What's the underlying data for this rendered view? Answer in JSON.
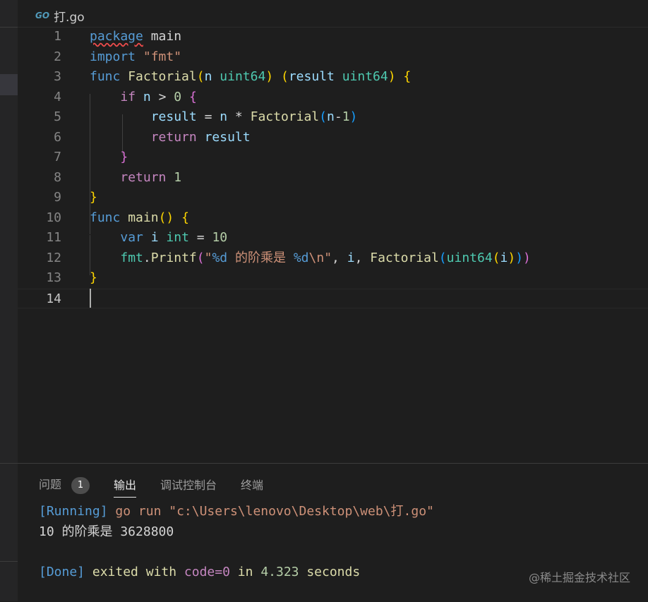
{
  "tab": {
    "icon": "go-file-icon",
    "icon_text": "GO",
    "filename": "打.go"
  },
  "editor": {
    "current_line": "14",
    "lines": [
      {
        "n": "1",
        "segs": [
          {
            "t": "package",
            "c": "kw squiggle"
          },
          {
            "t": " main",
            "c": ""
          }
        ]
      },
      {
        "n": "2",
        "segs": [
          {
            "t": "import",
            "c": "kw"
          },
          {
            "t": " ",
            "c": ""
          },
          {
            "t": "\"fmt\"",
            "c": "str"
          }
        ]
      },
      {
        "n": "3",
        "segs": [
          {
            "t": "func",
            "c": "kw"
          },
          {
            "t": " ",
            "c": ""
          },
          {
            "t": "Factorial",
            "c": "fn"
          },
          {
            "t": "(",
            "c": "b1"
          },
          {
            "t": "n ",
            "c": "vr"
          },
          {
            "t": "uint64",
            "c": "ty"
          },
          {
            "t": ")",
            "c": "b1"
          },
          {
            "t": " ",
            "c": ""
          },
          {
            "t": "(",
            "c": "b1"
          },
          {
            "t": "result ",
            "c": "vr"
          },
          {
            "t": "uint64",
            "c": "ty"
          },
          {
            "t": ")",
            "c": "b1"
          },
          {
            "t": " ",
            "c": ""
          },
          {
            "t": "{",
            "c": "b1"
          }
        ]
      },
      {
        "n": "4",
        "segs": [
          {
            "t": "    ",
            "c": ""
          },
          {
            "t": "if",
            "c": "kc"
          },
          {
            "t": " ",
            "c": ""
          },
          {
            "t": "n",
            "c": "vr"
          },
          {
            "t": " > ",
            "c": ""
          },
          {
            "t": "0",
            "c": "num"
          },
          {
            "t": " ",
            "c": ""
          },
          {
            "t": "{",
            "c": "b2"
          }
        ]
      },
      {
        "n": "5",
        "segs": [
          {
            "t": "        ",
            "c": ""
          },
          {
            "t": "result",
            "c": "vr"
          },
          {
            "t": " = ",
            "c": ""
          },
          {
            "t": "n",
            "c": "vr"
          },
          {
            "t": " * ",
            "c": ""
          },
          {
            "t": "Factorial",
            "c": "fn"
          },
          {
            "t": "(",
            "c": "b3"
          },
          {
            "t": "n",
            "c": "vr"
          },
          {
            "t": "-",
            "c": ""
          },
          {
            "t": "1",
            "c": "num"
          },
          {
            "t": ")",
            "c": "b3"
          }
        ]
      },
      {
        "n": "6",
        "segs": [
          {
            "t": "        ",
            "c": ""
          },
          {
            "t": "return",
            "c": "kc"
          },
          {
            "t": " ",
            "c": ""
          },
          {
            "t": "result",
            "c": "vr"
          }
        ]
      },
      {
        "n": "7",
        "segs": [
          {
            "t": "    ",
            "c": ""
          },
          {
            "t": "}",
            "c": "b2"
          }
        ]
      },
      {
        "n": "8",
        "segs": [
          {
            "t": "    ",
            "c": ""
          },
          {
            "t": "return",
            "c": "kc"
          },
          {
            "t": " ",
            "c": ""
          },
          {
            "t": "1",
            "c": "num"
          }
        ]
      },
      {
        "n": "9",
        "segs": [
          {
            "t": "}",
            "c": "b1"
          }
        ]
      },
      {
        "n": "10",
        "segs": [
          {
            "t": "func",
            "c": "kw"
          },
          {
            "t": " ",
            "c": ""
          },
          {
            "t": "main",
            "c": "fn"
          },
          {
            "t": "()",
            "c": "b1"
          },
          {
            "t": " ",
            "c": ""
          },
          {
            "t": "{",
            "c": "b1"
          }
        ]
      },
      {
        "n": "11",
        "segs": [
          {
            "t": "    ",
            "c": ""
          },
          {
            "t": "var",
            "c": "kw"
          },
          {
            "t": " ",
            "c": ""
          },
          {
            "t": "i",
            "c": "vr"
          },
          {
            "t": " ",
            "c": ""
          },
          {
            "t": "int",
            "c": "ty"
          },
          {
            "t": " = ",
            "c": ""
          },
          {
            "t": "10",
            "c": "num"
          }
        ]
      },
      {
        "n": "12",
        "segs": [
          {
            "t": "    ",
            "c": ""
          },
          {
            "t": "fmt",
            "c": "ty"
          },
          {
            "t": ".",
            "c": ""
          },
          {
            "t": "Printf",
            "c": "fn"
          },
          {
            "t": "(",
            "c": "b2"
          },
          {
            "t": "\"",
            "c": "str"
          },
          {
            "t": "%d",
            "c": "fmt"
          },
          {
            "t": " 的阶乘是 ",
            "c": "str"
          },
          {
            "t": "%d",
            "c": "fmt"
          },
          {
            "t": "\\n",
            "c": "str"
          },
          {
            "t": "\"",
            "c": "str"
          },
          {
            "t": ", ",
            "c": ""
          },
          {
            "t": "i",
            "c": "vr"
          },
          {
            "t": ", ",
            "c": ""
          },
          {
            "t": "Factorial",
            "c": "fn"
          },
          {
            "t": "(",
            "c": "b3"
          },
          {
            "t": "uint64",
            "c": "ty"
          },
          {
            "t": "(",
            "c": "b1"
          },
          {
            "t": "i",
            "c": "vr"
          },
          {
            "t": ")",
            "c": "b1"
          },
          {
            "t": ")",
            "c": "b3"
          },
          {
            "t": ")",
            "c": "b2"
          }
        ]
      },
      {
        "n": "13",
        "segs": [
          {
            "t": "}",
            "c": "b1"
          }
        ]
      },
      {
        "n": "14",
        "segs": []
      }
    ]
  },
  "panel": {
    "tabs": [
      {
        "label": "问题",
        "badge": "1",
        "active": false
      },
      {
        "label": "输出",
        "active": true
      },
      {
        "label": "调试控制台",
        "active": false
      },
      {
        "label": "终端",
        "active": false
      }
    ],
    "output": [
      [
        {
          "t": "[Running]",
          "c": "o-blue"
        },
        {
          "t": " go run ",
          "c": "o-orange"
        },
        {
          "t": "\"c:\\Users\\lenovo\\Desktop\\web\\打.go\"",
          "c": "o-orange"
        }
      ],
      [
        {
          "t": "10 的阶乘是 3628800",
          "c": "o-white"
        }
      ],
      [],
      [
        {
          "t": "[Done]",
          "c": "o-blue"
        },
        {
          "t": " exited with ",
          "c": "o-fn"
        },
        {
          "t": "code=0",
          "c": "o-purple"
        },
        {
          "t": " in ",
          "c": "o-fn"
        },
        {
          "t": "4.323",
          "c": "o-num"
        },
        {
          "t": " seconds",
          "c": "o-fn"
        }
      ]
    ]
  },
  "watermark": "@稀土掘金技术社区"
}
